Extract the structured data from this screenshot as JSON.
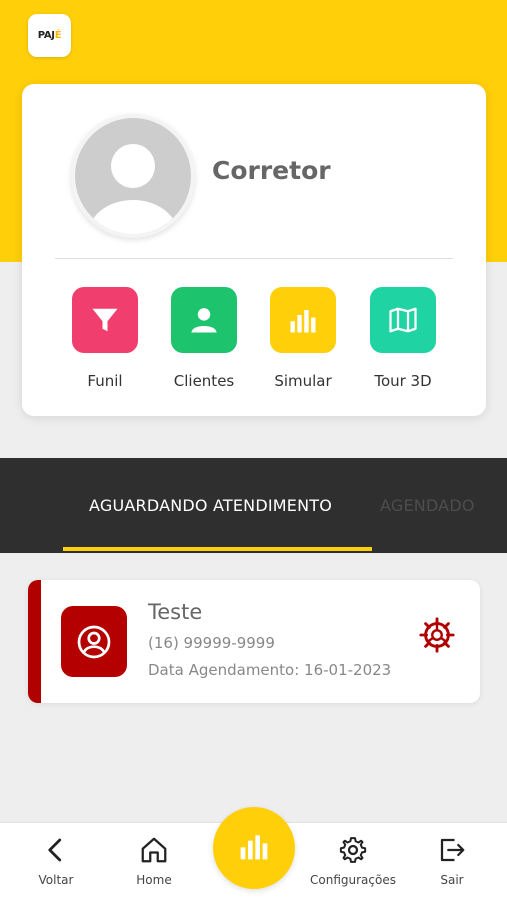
{
  "app": {
    "logo_text": "PAJÉ",
    "accent_color": "#ffcf0a"
  },
  "profile": {
    "name": "Corretor",
    "actions": [
      {
        "label": "Funil",
        "icon": "funnel-icon",
        "color": "#f03f6e"
      },
      {
        "label": "Clientes",
        "icon": "person-icon",
        "color": "#1ec36d"
      },
      {
        "label": "Simular",
        "icon": "bar-chart-icon",
        "color": "#ffcf0a"
      },
      {
        "label": "Tour 3D",
        "icon": "map-icon",
        "color": "#20d3a3"
      }
    ]
  },
  "tabs": [
    {
      "label": "AGUARDANDO ATENDIMENTO",
      "active": true
    },
    {
      "label": "AGENDADO",
      "active": false
    }
  ],
  "appointments": [
    {
      "name": "Teste",
      "phone": "(16) 99999-9999",
      "date_text": "Data Agendamento: 16-01-2023",
      "status_color": "#b00000",
      "avatar_icon": "user-circle-icon",
      "action_icon": "gear-icon"
    }
  ],
  "bottom_nav": {
    "items": [
      {
        "label": "Voltar",
        "icon": "chevron-left-icon"
      },
      {
        "label": "Home",
        "icon": "home-icon"
      },
      {
        "label": "Configurações",
        "icon": "gear-icon"
      },
      {
        "label": "Sair",
        "icon": "logout-icon"
      }
    ],
    "center_icon": "bar-chart-icon"
  }
}
